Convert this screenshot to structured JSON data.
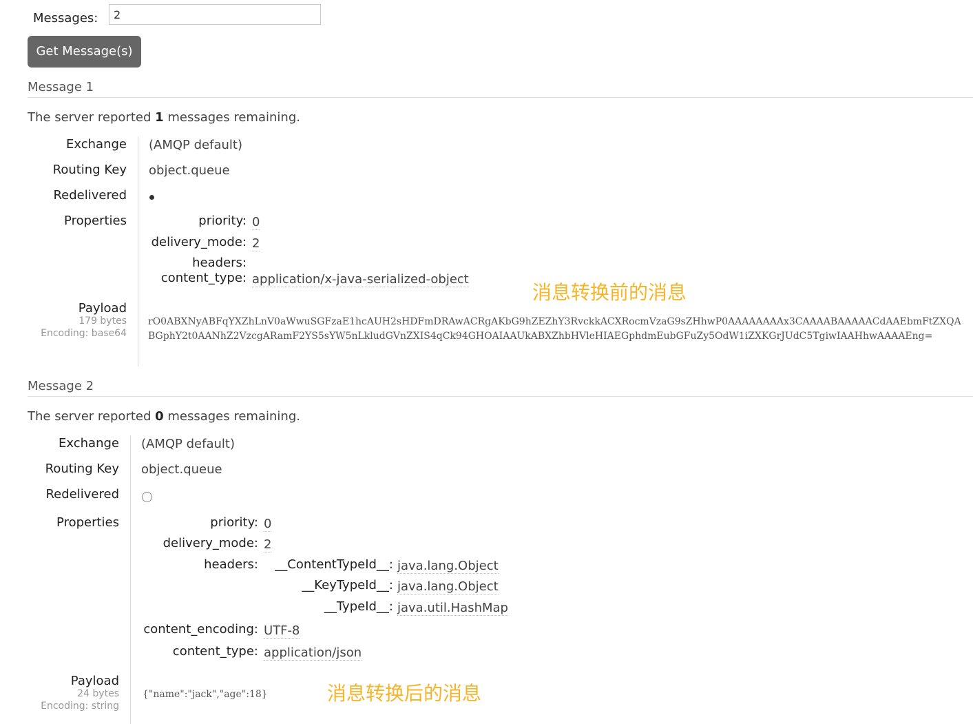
{
  "form": {
    "messages_label": "Messages:",
    "messages_value": "2",
    "get_button": "Get Message(s)"
  },
  "messages": [
    {
      "title": "Message 1",
      "remaining_prefix": "The server reported ",
      "remaining_count": "1",
      "remaining_suffix": " messages remaining.",
      "labels": {
        "exchange": "Exchange",
        "routing_key": "Routing Key",
        "redelivered": "Redelivered",
        "properties": "Properties",
        "payload": "Payload"
      },
      "exchange": "(AMQP default)",
      "routing_key": "object.queue",
      "redelivered": true,
      "properties": [
        {
          "key": "priority:",
          "value": "0"
        },
        {
          "key": "delivery_mode:",
          "value": "2"
        },
        {
          "key": "headers:",
          "value": ""
        },
        {
          "key": "content_type:",
          "value": "application/x-java-serialized-object"
        }
      ],
      "payload_size": "179 bytes",
      "payload_encoding": "Encoding: base64",
      "payload_line1": "rO0ABXNyABFqYXZhLnV0aWwuSGFzaE1hcAUH2sHDFmDRAwACRgAKbG9hZEZhY3RvckkACXRocmVzaG9sZHhwP0AAAAAAAAx3CAAAABAAAAACdAAEbmFtZXQA",
      "payload_line2": "BGphY2t0AANhZ2VzcgARamF2YS5sYW5nLkludGVnZXIS4qCk94GHOAIAAUkABXZhbHVleHIAEGphdmEubGFuZy5OdW1iZXKGrJUdC5TgiwIAAHhwAAAAEng=",
      "annotation": "消息转换前的消息"
    },
    {
      "title": "Message 2",
      "remaining_prefix": "The server reported ",
      "remaining_count": "0",
      "remaining_suffix": " messages remaining.",
      "labels": {
        "exchange": "Exchange",
        "routing_key": "Routing Key",
        "redelivered": "Redelivered",
        "properties": "Properties",
        "payload": "Payload"
      },
      "exchange": "(AMQP default)",
      "routing_key": "object.queue",
      "redelivered": false,
      "properties": [
        {
          "key": "priority:",
          "value": "0"
        },
        {
          "key": "delivery_mode:",
          "value": "2"
        },
        {
          "key": "headers:",
          "value": ""
        },
        {
          "key": "content_encoding:",
          "value": "UTF-8"
        },
        {
          "key": "content_type:",
          "value": "application/json"
        }
      ],
      "headers": [
        {
          "key": "__ContentTypeId__:",
          "value": "java.lang.Object"
        },
        {
          "key": "__KeyTypeId__:",
          "value": "java.lang.Object"
        },
        {
          "key": "__TypeId__:",
          "value": "java.util.HashMap"
        }
      ],
      "payload_size": "24 bytes",
      "payload_encoding": "Encoding: string",
      "payload_text": "{\"name\":\"jack\",\"age\":18}",
      "annotation": "消息转换后的消息"
    }
  ]
}
